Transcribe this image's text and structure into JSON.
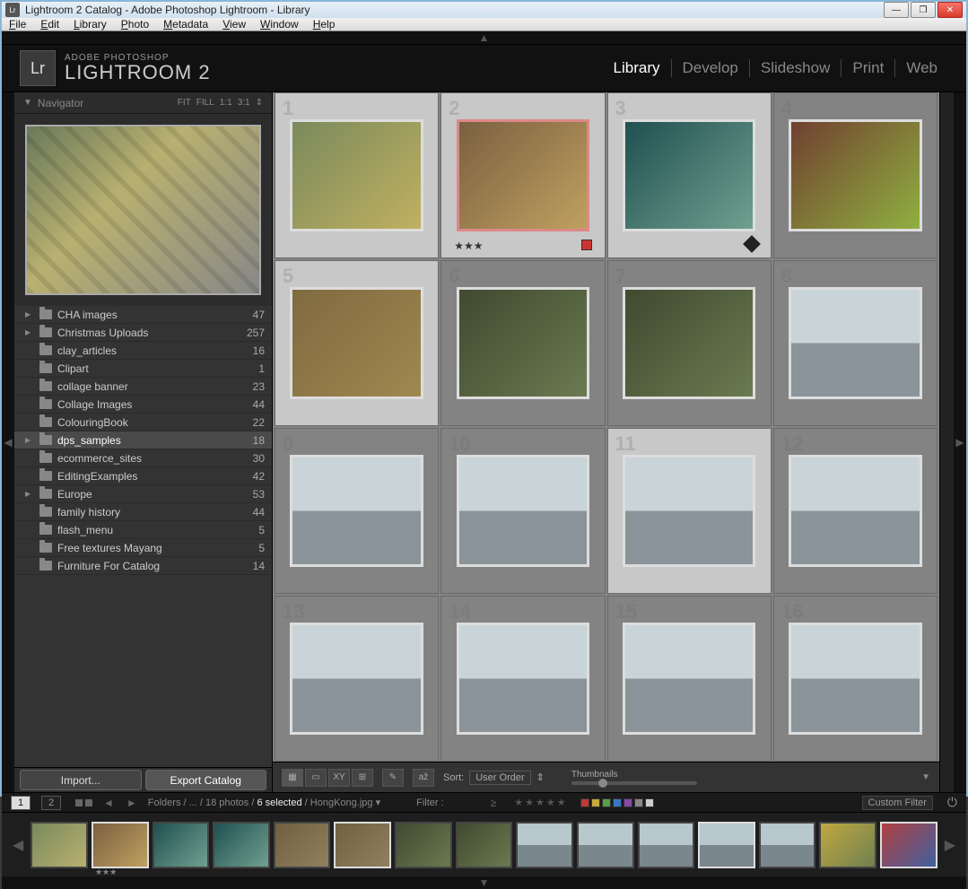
{
  "window": {
    "title": "Lightroom 2 Catalog - Adobe Photoshop Lightroom - Library"
  },
  "menubar": {
    "file": "File",
    "edit": "Edit",
    "library": "Library",
    "photo": "Photo",
    "metadata": "Metadata",
    "view": "View",
    "window": "Window",
    "help": "Help"
  },
  "brand": {
    "small": "ADOBE PHOTOSHOP",
    "big": "LIGHTROOM 2",
    "logo": "Lr"
  },
  "modules": {
    "library": "Library",
    "develop": "Develop",
    "slideshow": "Slideshow",
    "print": "Print",
    "web": "Web"
  },
  "navigator": {
    "title": "Navigator",
    "zoom": [
      "FIT",
      "FILL",
      "1:1",
      "3:1"
    ]
  },
  "folders": [
    {
      "name": "CHA images",
      "count": 47,
      "expand": true
    },
    {
      "name": "Christmas Uploads",
      "count": 257,
      "expand": true
    },
    {
      "name": "clay_articles",
      "count": 16,
      "expand": false
    },
    {
      "name": "Clipart",
      "count": 1,
      "expand": false
    },
    {
      "name": "collage banner",
      "count": 23,
      "expand": false
    },
    {
      "name": "Collage Images",
      "count": 44,
      "expand": false
    },
    {
      "name": "ColouringBook",
      "count": 22,
      "expand": false
    },
    {
      "name": "dps_samples",
      "count": 18,
      "expand": true,
      "selected": true
    },
    {
      "name": "ecommerce_sites",
      "count": 30,
      "expand": false
    },
    {
      "name": "EditingExamples",
      "count": 42,
      "expand": false
    },
    {
      "name": "Europe",
      "count": 53,
      "expand": true
    },
    {
      "name": "family history",
      "count": 44,
      "expand": false
    },
    {
      "name": "flash_menu",
      "count": 5,
      "expand": false
    },
    {
      "name": "Free textures Mayang",
      "count": 5,
      "expand": false
    },
    {
      "name": "Furniture For Catalog",
      "count": 14,
      "expand": false
    }
  ],
  "leftbuttons": {
    "import": "Import...",
    "export": "Export Catalog"
  },
  "grid_cells": [
    {
      "n": 1,
      "sel": true,
      "style": "yellow"
    },
    {
      "n": 2,
      "sel": true,
      "style": "gold",
      "stars": "★★★",
      "redborder": true,
      "flag": true
    },
    {
      "n": 3,
      "sel": true,
      "style": "teal",
      "badge": true
    },
    {
      "n": 4,
      "sel": false,
      "style": "fruit"
    },
    {
      "n": 5,
      "sel": true,
      "style": "olive"
    },
    {
      "n": 6,
      "sel": false,
      "style": "green"
    },
    {
      "n": 7,
      "sel": false,
      "style": "green"
    },
    {
      "n": 8,
      "sel": false,
      "style": "sky"
    },
    {
      "n": 9,
      "sel": false,
      "style": "sky"
    },
    {
      "n": 10,
      "sel": false,
      "style": "sky"
    },
    {
      "n": 11,
      "sel": true,
      "style": "sky"
    },
    {
      "n": 12,
      "sel": false,
      "style": "sky"
    },
    {
      "n": 13,
      "sel": false,
      "style": "sky"
    },
    {
      "n": 14,
      "sel": false,
      "style": "sky"
    },
    {
      "n": 15,
      "sel": false,
      "style": "sky"
    },
    {
      "n": 16,
      "sel": false,
      "style": "sky"
    }
  ],
  "toolbar": {
    "sort_label": "Sort:",
    "sort_value": "User Order",
    "thumb_label": "Thumbnails"
  },
  "infobar": {
    "page1": "1",
    "page2": "2",
    "crumb_pre": "Folders / ... / 18 photos / ",
    "crumb_sel": "6 selected",
    "crumb_post": " / HongKong.jpg",
    "filter": "Filter :",
    "custom": "Custom Filter"
  },
  "color_swatches": [
    "#c03838",
    "#c8a838",
    "#58a048",
    "#3878c0",
    "#8848a8",
    "#888888",
    "#cccccc"
  ],
  "filmstrip": [
    {
      "style": "tram",
      "sel": false
    },
    {
      "style": "gold",
      "sel": true,
      "stars": "★★★"
    },
    {
      "style": "teal",
      "sel": false
    },
    {
      "style": "teal",
      "sel": false
    },
    {
      "style": "build",
      "sel": false
    },
    {
      "style": "build",
      "sel": true
    },
    {
      "style": "green",
      "sel": false
    },
    {
      "style": "green",
      "sel": false
    },
    {
      "style": "sky",
      "sel": false
    },
    {
      "style": "sky",
      "sel": false
    },
    {
      "style": "sky",
      "sel": false
    },
    {
      "style": "sky",
      "sel": true
    },
    {
      "style": "sky",
      "sel": false
    },
    {
      "style": "yellow2",
      "sel": false
    },
    {
      "style": "mix",
      "sel": true
    }
  ]
}
